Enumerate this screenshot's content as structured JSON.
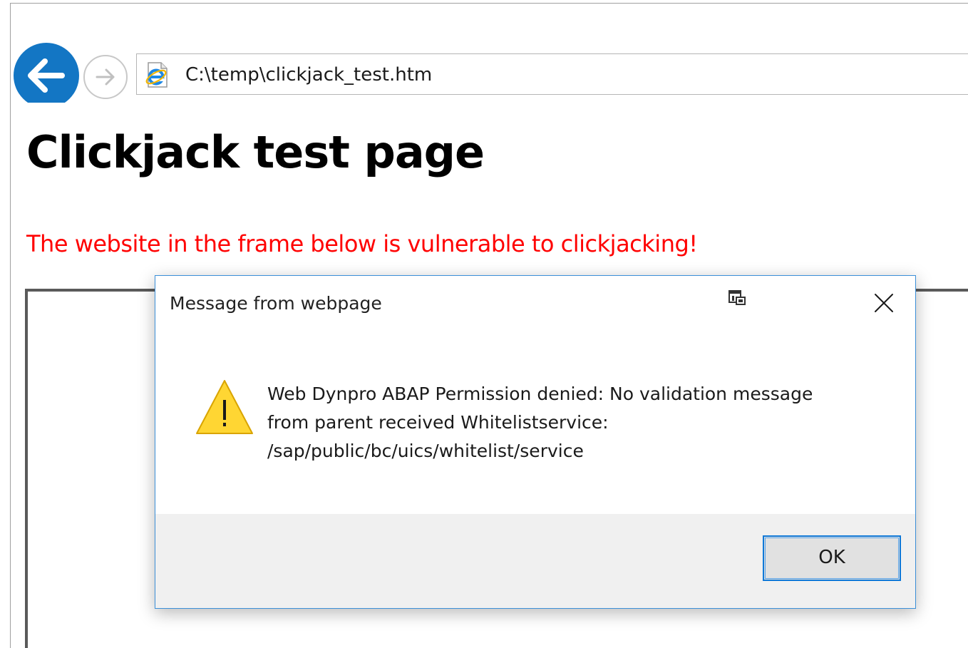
{
  "browser": {
    "address": "C:\\temp\\clickjack_test.htm",
    "back_icon": "back-arrow-icon",
    "forward_icon": "forward-arrow-icon",
    "site_icon": "internet-explorer-icon",
    "accent_color": "#1376c4"
  },
  "page": {
    "title": "Clickjack test page",
    "warning": "The website in the frame below is vulnerable to clickjacking!",
    "warning_color": "#ff0000"
  },
  "dialog": {
    "title": "Message from webpage",
    "devtools_icon": "developer-tools-icon",
    "close_icon": "close-icon",
    "warning_icon": "warning-triangle-icon",
    "message_lines": [
      "Web Dynpro ABAP Permission denied: No validation message",
      "from parent received Whitelistservice:",
      "/sap/public/bc/uics/whitelist/service"
    ],
    "ok_label": "OK"
  }
}
